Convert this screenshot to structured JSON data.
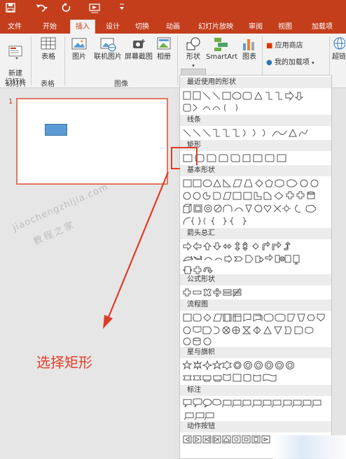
{
  "quick_access": {
    "save_icon": "save-icon",
    "undo_icon": "undo-icon",
    "redo_icon": "redo-icon",
    "present_icon": "present-icon",
    "more_icon": "more-icon"
  },
  "tabs": [
    "文件",
    "开始",
    "插入",
    "设计",
    "切换",
    "动画",
    "幻灯片放映",
    "审阅",
    "视图",
    "加载项"
  ],
  "active_tab": "插入",
  "ribbon": {
    "new_slide": "新建\n幻灯片",
    "table": "表格",
    "picture": "图片",
    "online_picture": "联机图片",
    "screenshot": "屏幕截图",
    "album": "相册",
    "shapes": "形状",
    "smartart": "SmartArt",
    "chart": "图表",
    "app_store": "应用商店",
    "my_addins": "我的加载项",
    "hyperlink": "超链",
    "group_slides": "幻灯片",
    "group_tables": "表格",
    "group_images": "图像"
  },
  "slide_panel": {
    "slide_number": "1"
  },
  "watermark": {
    "line1": "jiaochengzhijia.com",
    "line2": "教程之家"
  },
  "annotation": "选择矩形",
  "shapes_menu": {
    "sections": [
      "最近使用的形状",
      "线条",
      "矩形",
      "基本形状",
      "箭头总汇",
      "公式形状",
      "流程图",
      "星与旗帜",
      "标注",
      "动作按钮"
    ]
  },
  "colors": {
    "accent": "#c43e1c",
    "highlight": "#e03c28",
    "shape_fill": "#5b9bd5"
  }
}
